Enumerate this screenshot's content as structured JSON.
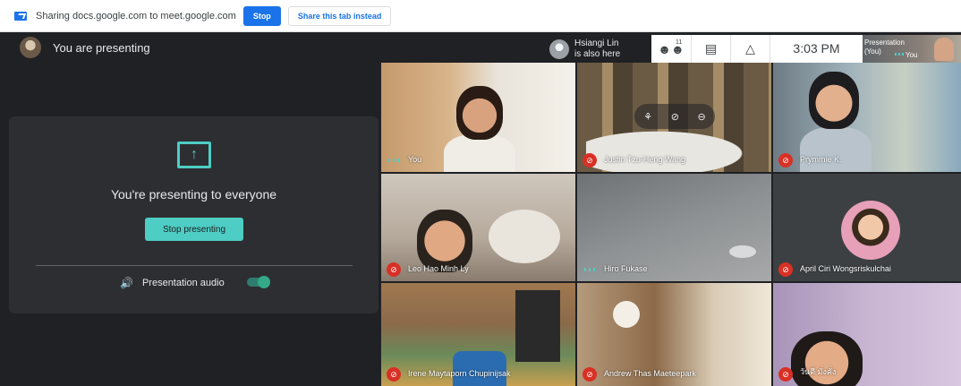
{
  "share_bar": {
    "text": "Sharing docs.google.com to meet.google.com",
    "stop_label": "Stop",
    "share_tab_label": "Share this tab instead"
  },
  "top_bar": {
    "title": "You are presenting",
    "also_here_name": "Hsiangi Lin",
    "also_here_suffix": "is also here",
    "people_count": "11",
    "time": "3:03 PM",
    "self_thumb_label_1": "Presentation",
    "self_thumb_label_2": "(You)",
    "self_thumb_name": "You"
  },
  "present_panel": {
    "title": "You're presenting to everyone",
    "stop_presenting_label": "Stop presenting",
    "audio_label": "Presentation audio",
    "audio_enabled": true
  },
  "participants": [
    {
      "name": "You",
      "muted": false
    },
    {
      "name": "Justin Tzu-Heng Wang",
      "muted": true
    },
    {
      "name": "Prymmie K.",
      "muted": true
    },
    {
      "name": "Leo Hao Minh Ly",
      "muted": true
    },
    {
      "name": "Hiro Fukase",
      "muted": false
    },
    {
      "name": "April Ciri Wongsriskulchai",
      "muted": true
    },
    {
      "name": "Irene Maytaporn Chupinijsak",
      "muted": true
    },
    {
      "name": "Andrew Thas Maeteepark",
      "muted": true
    },
    {
      "name": "วันดี มั่งคั่ง",
      "muted": true
    }
  ],
  "colors": {
    "accent": "#4ecdc4",
    "blue": "#1a73e8",
    "mute_red": "#d93025",
    "background": "#202124"
  }
}
